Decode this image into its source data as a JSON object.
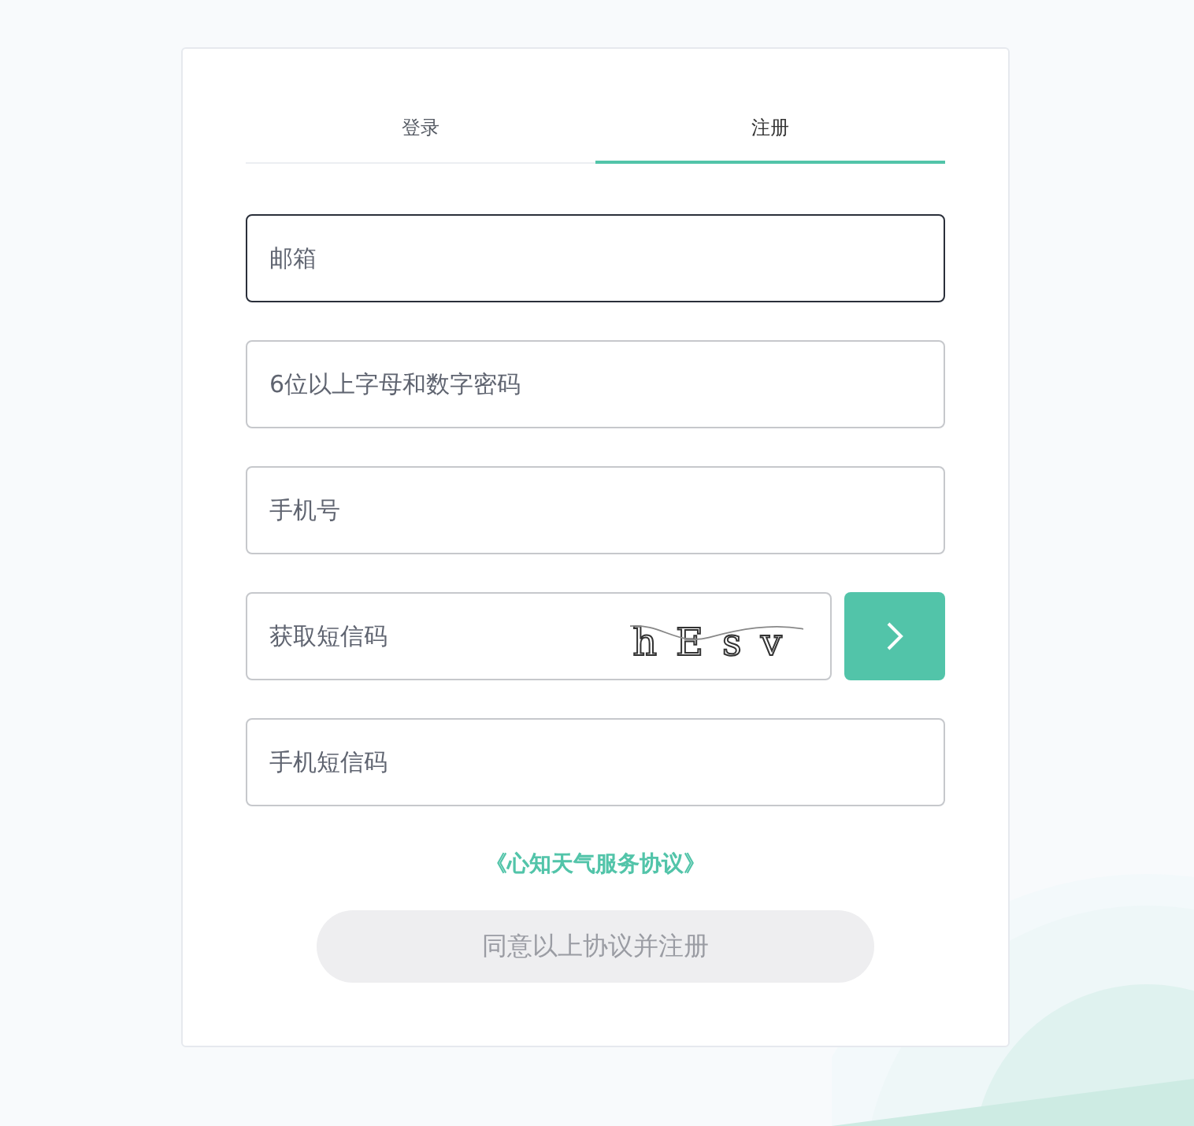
{
  "tabs": [
    {
      "label": "登录",
      "selected": false
    },
    {
      "label": "注册",
      "selected": true
    }
  ],
  "fields": [
    {
      "kind": "text",
      "placeholder": "邮箱",
      "focused": true
    },
    {
      "kind": "text",
      "placeholder": "6位以上字母和数字密码",
      "focused": false
    },
    {
      "kind": "text",
      "placeholder": "手机号",
      "focused": false
    },
    {
      "kind": "captcha",
      "placeholder": "获取短信码",
      "focused": false,
      "captcha": "hEsv"
    },
    {
      "kind": "text",
      "placeholder": "手机短信码",
      "focused": false
    }
  ],
  "agreement_link": "《心知天气服务协议》",
  "submit": {
    "label": "同意以上协议并注册",
    "disabled": true
  }
}
